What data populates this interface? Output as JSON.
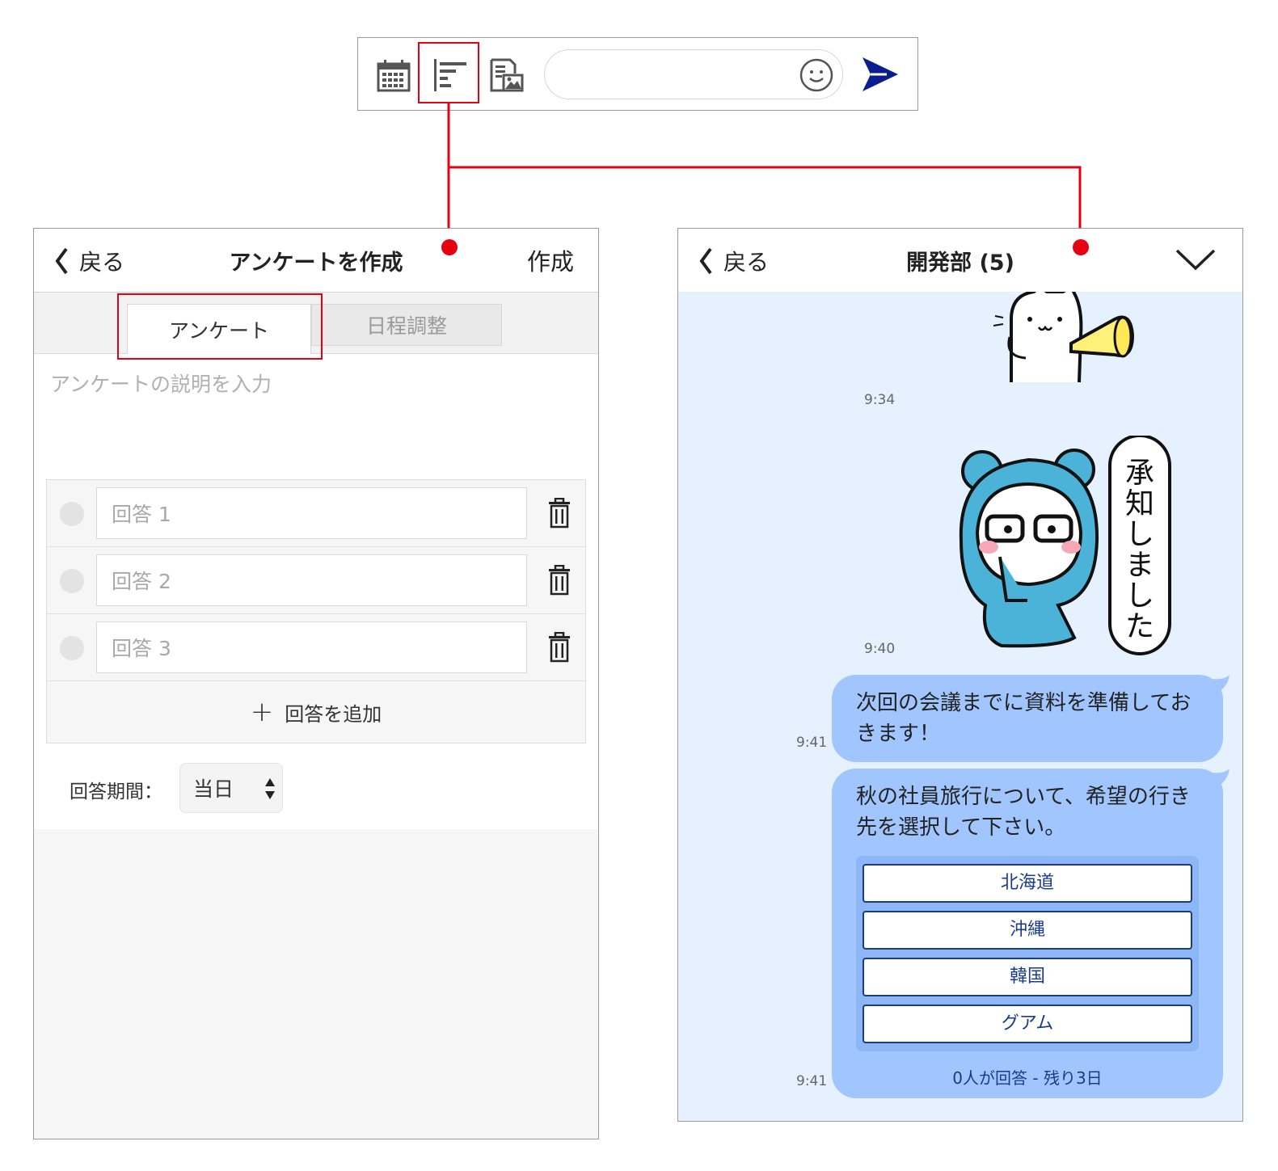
{
  "toolbar": {
    "icons": [
      "calendar-icon",
      "poll-icon",
      "image-icon",
      "emoji-icon",
      "send-icon"
    ],
    "input_placeholder": ""
  },
  "colors": {
    "highlight": "#e50012",
    "chat_background": "#e6f1ff",
    "bubble": "#a1c6ff",
    "poll_text": "#1a3a8a",
    "send": "#0b1e8f"
  },
  "left_panel": {
    "back_label": "戻る",
    "title": "アンケートを作成",
    "action_label": "作成",
    "tabs": [
      {
        "label": "アンケート",
        "active": true
      },
      {
        "label": "日程調整",
        "active": false
      }
    ],
    "description_placeholder": "アンケートの説明を入力",
    "answers": [
      {
        "placeholder": "回答 1"
      },
      {
        "placeholder": "回答 2"
      },
      {
        "placeholder": "回答 3"
      }
    ],
    "add_answer_label": "回答を追加",
    "period_label": "回答期間：",
    "period_value": "当日"
  },
  "right_panel": {
    "back_label": "戻る",
    "title": "開発部 (5)",
    "messages": [
      {
        "type": "sticker",
        "name": "cat-megaphone-sticker",
        "time": "9:34"
      },
      {
        "type": "sticker",
        "name": "bear-hood-sticker",
        "text": "承知しました",
        "time": "9:40"
      },
      {
        "type": "text",
        "time": "9:41",
        "text": "次回の会議までに資料を準備しておきます！"
      },
      {
        "type": "poll",
        "time": "9:41",
        "question": "秋の社員旅行について、希望の行き先を選択して下さい。",
        "options": [
          "北海道",
          "沖縄",
          "韓国",
          "グアム"
        ],
        "footer": "0人が回答 - 残り3日"
      }
    ]
  }
}
